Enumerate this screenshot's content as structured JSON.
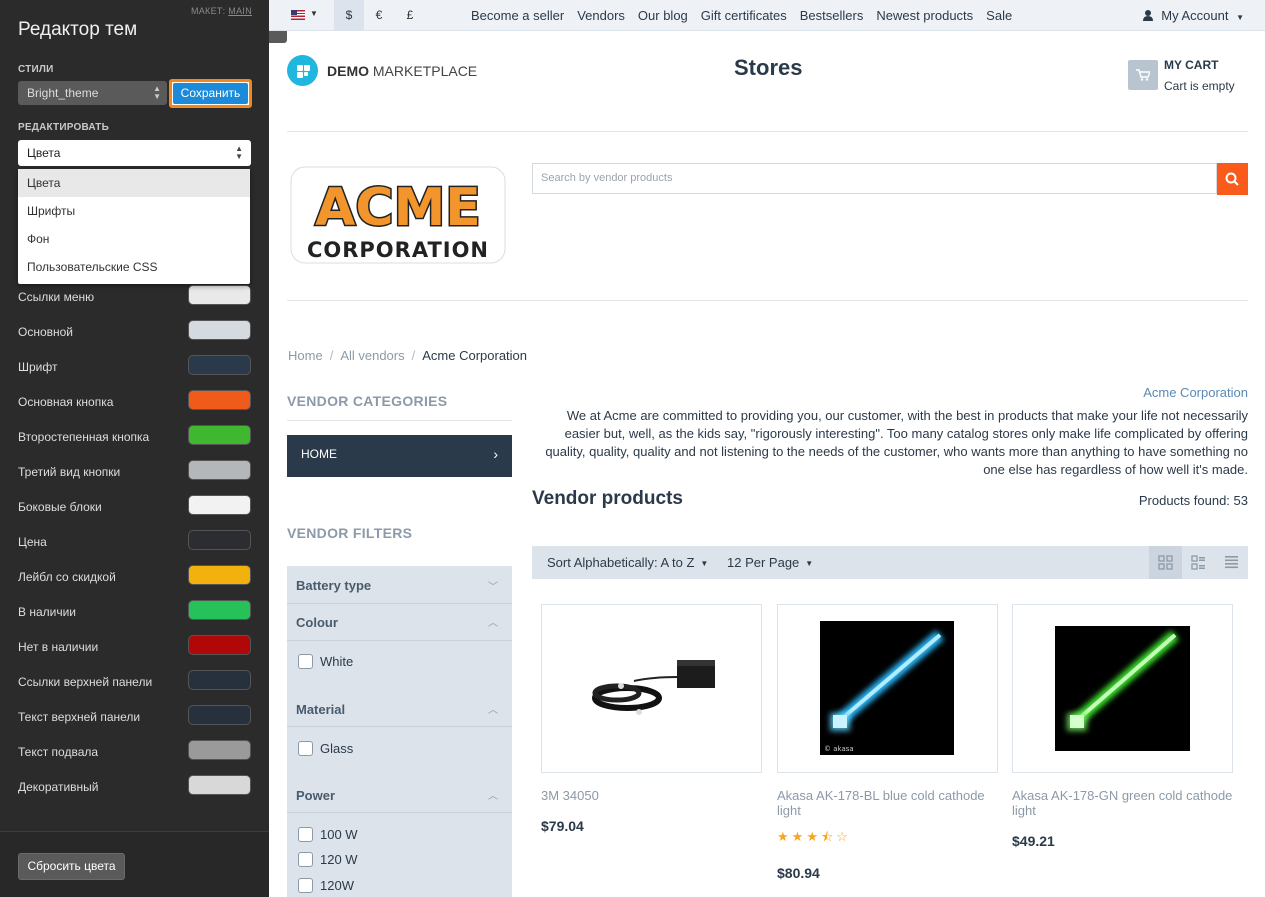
{
  "editor": {
    "layout_label": "МАКЕТ:",
    "layout_value": "MAIN",
    "title": "Редактор тем",
    "styles_label": "СТИЛИ",
    "theme_value": "Bright_theme",
    "save_label": "Сохранить",
    "edit_label": "РЕДАКТИРОВАТЬ",
    "edit_value": "Цвета",
    "dropdown": [
      "Цвета",
      "Шрифты",
      "Фон",
      "Пользовательские CSS"
    ],
    "colors": [
      {
        "label": "Ссылки меню",
        "color": "#e9e9e9"
      },
      {
        "label": "Основной",
        "color": "#d5d9e0"
      },
      {
        "label": "Шрифт",
        "color": "#2b3a4a"
      },
      {
        "label": "Основная кнопка",
        "color": "#f05a1a"
      },
      {
        "label": "Второстепенная кнопка",
        "color": "#3fb72e"
      },
      {
        "label": "Третий вид кнопки",
        "color": "#b4b7ba"
      },
      {
        "label": "Боковые блоки",
        "color": "#f2f2f2"
      },
      {
        "label": "Цена",
        "color": "#2b2d30"
      },
      {
        "label": "Лейбл со скидкой",
        "color": "#f2b10c"
      },
      {
        "label": "В наличии",
        "color": "#27c15a"
      },
      {
        "label": "Нет в наличии",
        "color": "#b00808"
      },
      {
        "label": "Ссылки верхней панели",
        "color": "#27313e"
      },
      {
        "label": "Текст верхней панели",
        "color": "#27313e"
      },
      {
        "label": "Текст подвала",
        "color": "#9a9a9a"
      },
      {
        "label": "Декоративный",
        "color": "#d8d8d8"
      }
    ],
    "reset_label": "Сбросить цвета",
    "toggle_icon": "chevron-left-icon"
  },
  "topbar": {
    "currencies": [
      "$",
      "€",
      "£"
    ],
    "links": [
      "Become a seller",
      "Vendors",
      "Our blog",
      "Gift certificates",
      "Bestsellers",
      "Newest products",
      "Sale"
    ],
    "account": "My Account"
  },
  "header": {
    "logo_bold": "DEMO",
    "logo_rest": "MARKETPLACE",
    "page_title": "Stores",
    "cart_title": "MY CART",
    "cart_status": "Cart is empty"
  },
  "vendor": {
    "search_placeholder": "Search by vendor products",
    "breadcrumb": [
      "Home",
      "All vendors",
      "Acme Corporation"
    ],
    "name": "Acme Corporation",
    "description": "We at Acme are committed to providing you, our customer, with the best in products that make your life not necessarily easier but, well, as the kids say, \"rigorously interesting\". Too many catalog stores only make life complicated by offering quality, quality, quality and not listening to the needs of the customer, who wants more than anything to have something no one else has regardless of how well it's made.",
    "logo_line1": "ACME",
    "logo_line2": "CORPORATION"
  },
  "sidebar": {
    "categories_title": "VENDOR CATEGORIES",
    "home_label": "HOME",
    "filters_title": "VENDOR FILTERS",
    "filters": [
      {
        "title": "Battery type",
        "open": false
      },
      {
        "title": "Colour",
        "open": true,
        "options": [
          "White"
        ]
      },
      {
        "title": "Material",
        "open": true,
        "options": [
          "Glass"
        ]
      },
      {
        "title": "Power",
        "open": true,
        "options": [
          "100 W",
          "120 W",
          "120W"
        ]
      }
    ]
  },
  "products": {
    "title": "Vendor products",
    "found": "Products found: 53",
    "sort_label": "Sort Alphabetically: A to Z",
    "per_page": "12 Per Page",
    "items": [
      {
        "name": "3M 34050",
        "price": "$79.04",
        "rating": 0
      },
      {
        "name": "Akasa AK-178-BL blue cold cathode light",
        "price": "$80.94",
        "rating": 3.5,
        "image_mark": "© akasa"
      },
      {
        "name": "Akasa AK-178-GN green cold cathode light",
        "price": "$49.21",
        "rating": 0
      }
    ]
  },
  "colors": {
    "accent": "#fa5a1a",
    "dark": "#2b3a4a",
    "link": "#5a8ab5",
    "panel": "#2b2b2b"
  }
}
